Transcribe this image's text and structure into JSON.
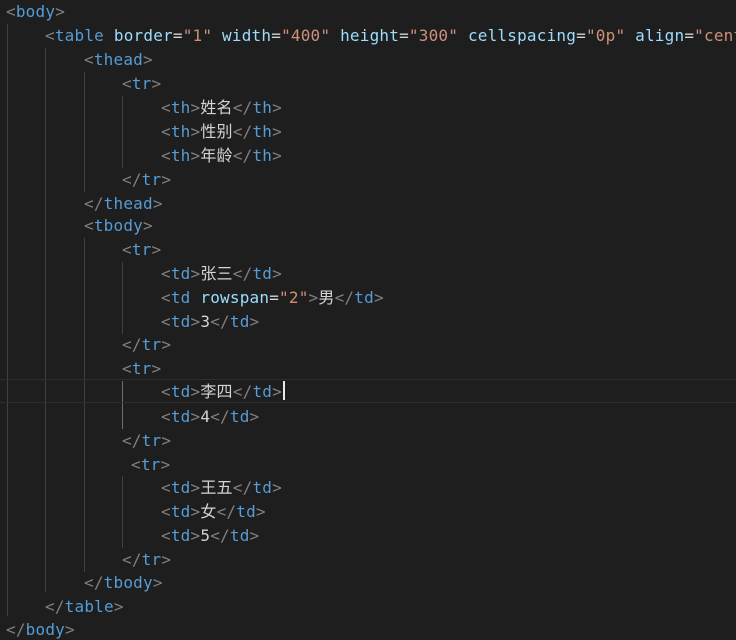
{
  "editor": {
    "theme_colors": {
      "background": "#1e1e1e",
      "tag": "#569cd6",
      "bracket": "#808080",
      "attribute": "#9cdcfe",
      "string": "#ce9178",
      "text": "#d4d4d4"
    },
    "code": {
      "body_tag": "body",
      "table_tag": "table",
      "table_attrs": [
        {
          "name": "border",
          "value": "\"1\""
        },
        {
          "name": "width",
          "value": "\"400\""
        },
        {
          "name": "height",
          "value": "\"300\""
        },
        {
          "name": "cellspacing",
          "value": "\"0p\""
        },
        {
          "name": "align",
          "value": "\"cente"
        }
      ],
      "thead_tag": "thead",
      "tbody_tag": "tbody",
      "tr_tag": "tr",
      "th_tag": "th",
      "td_tag": "td",
      "rowspan_attr": {
        "name": "rowspan",
        "value": "\"2\""
      },
      "headers": [
        "姓名",
        "性别",
        "年龄"
      ],
      "rows": [
        {
          "name": "张三",
          "gender": "男",
          "age": "3"
        },
        {
          "name": "李四",
          "age": "4"
        },
        {
          "name": "王五",
          "gender": "女",
          "age": "5"
        }
      ]
    }
  }
}
